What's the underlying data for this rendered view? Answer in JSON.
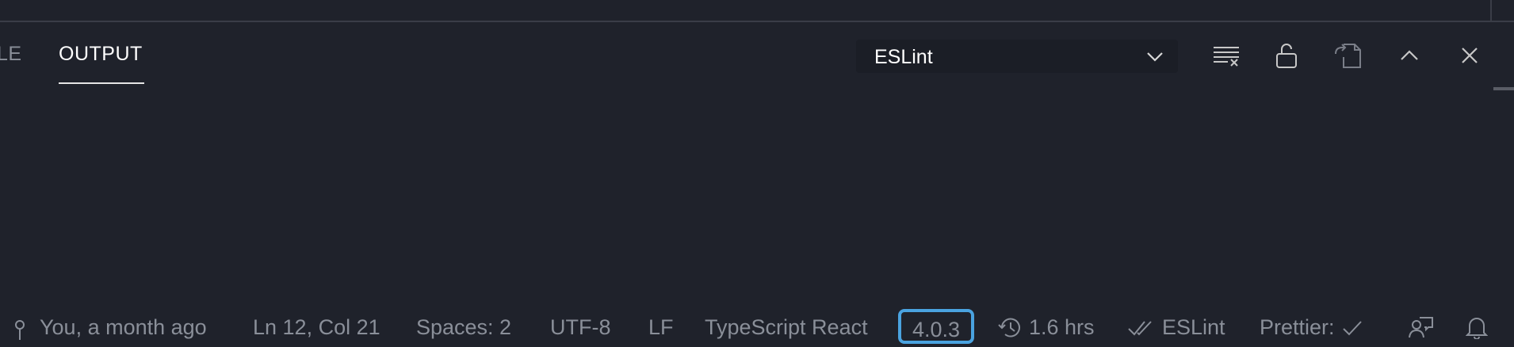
{
  "panel": {
    "tabs": [
      {
        "label": "LE",
        "active": false
      },
      {
        "label": "OUTPUT",
        "active": true
      }
    ],
    "output_channel": {
      "selected": "ESLint"
    },
    "toolbar": [
      {
        "icon": "clear-output-icon"
      },
      {
        "icon": "lock-icon"
      },
      {
        "icon": "open-in-editor-icon"
      },
      {
        "icon": "chevron-up-icon"
      },
      {
        "icon": "close-icon"
      }
    ]
  },
  "statusbar": {
    "git_blame": "You, a month ago",
    "cursor_position": "Ln 12, Col 21",
    "indentation": "Spaces: 2",
    "encoding": "UTF-8",
    "eol": "LF",
    "language": "TypeScript React",
    "ts_version": "4.0.3",
    "time_tracked": "1.6 hrs",
    "linter": "ESLint",
    "formatter": "Prettier:",
    "colors": {
      "highlight_border": "#4aa3e0",
      "text": "#8a8f99",
      "background": "#1f222b"
    }
  }
}
